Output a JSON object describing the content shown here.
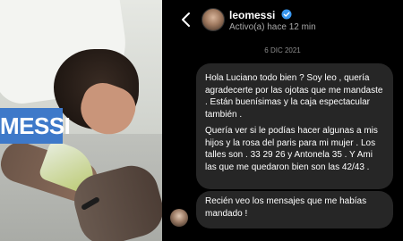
{
  "photo": {
    "caption": "MESSI"
  },
  "dm": {
    "username": "leomessi",
    "status": "Activo(a) hace 12 min",
    "date": "6 DIC 2021",
    "message1_para1": "Hola Luciano todo bien ? Soy leo , quería agradecerte por las ojotas que me mandaste . Están buenísimas y la caja espectacular también .",
    "message1_para2": "Quería ver si le podías hacer algunas a mis hijos y la rosa del paris para mi mujer . Los talles son .  33 29 26 y Antonela 35 . Y Ami las que me quedaron bien son las 42/43 .",
    "message2": "Recién veo los mensajes que me habías mandado !",
    "icons": {
      "back": "chevron-left-icon",
      "verified": "verified-badge-icon"
    },
    "colors": {
      "background": "#000000",
      "bubble": "#262626",
      "verified": "#3897f0",
      "caption_bg": "#3e79c9"
    }
  }
}
